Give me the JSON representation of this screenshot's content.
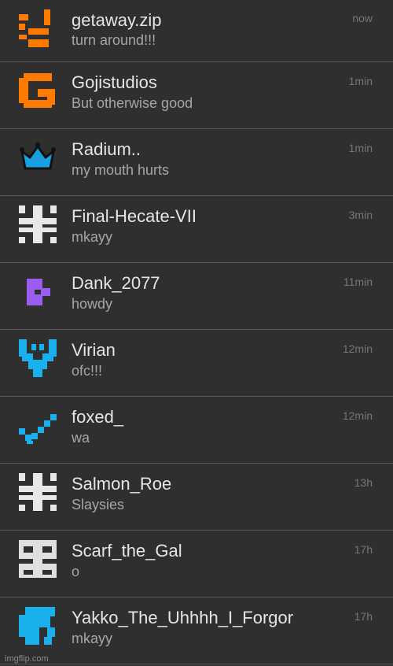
{
  "conversations": [
    {
      "name": "getaway.zip",
      "message": "turn around!!!",
      "time": "now",
      "avatar_icon": "orange-pixel-glyph-icon",
      "avatar_color": "#ff7a00"
    },
    {
      "name": "Gojistudios",
      "message": "But otherwise good",
      "time": "1min",
      "avatar_icon": "orange-g-logo-icon",
      "avatar_color": "#ff7a00"
    },
    {
      "name": "Radium..",
      "message": "my mouth hurts",
      "time": "1min",
      "avatar_icon": "blue-crown-icon",
      "avatar_color": "#1aa0e0"
    },
    {
      "name": "Final-Hecate-VII",
      "message": "mkayy",
      "time": "3min",
      "avatar_icon": "white-pixel-grid-icon",
      "avatar_color": "#e8e8e8"
    },
    {
      "name": "Dank_2077",
      "message": "howdy",
      "time": "11min",
      "avatar_icon": "purple-pixel-icon",
      "avatar_color": "#9b5cf0"
    },
    {
      "name": "Virian",
      "message": "ofc!!!",
      "time": "12min",
      "avatar_icon": "cyan-pixel-shield-icon",
      "avatar_color": "#1ab0ee"
    },
    {
      "name": "foxed_",
      "message": "wa",
      "time": "12min",
      "avatar_icon": "cyan-pixel-check-icon",
      "avatar_color": "#1ab0ee"
    },
    {
      "name": "Salmon_Roe",
      "message": "Slaysies",
      "time": "13h",
      "avatar_icon": "white-pixel-grid-icon",
      "avatar_color": "#e8e8e8"
    },
    {
      "name": "Scarf_the_Gal",
      "message": "o",
      "time": "17h",
      "avatar_icon": "white-pixel-face-icon",
      "avatar_color": "#e0e0e0"
    },
    {
      "name": "Yakko_The_Uhhhh_I_Forgor",
      "message": "mkayy",
      "time": "17h",
      "avatar_icon": "cyan-pixel-blob-icon",
      "avatar_color": "#1ab0ee"
    }
  ],
  "watermark": "imgflip.com"
}
